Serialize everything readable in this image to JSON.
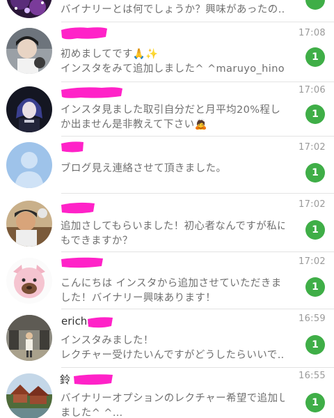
{
  "colors": {
    "badge": "#3fae47",
    "redaction": "#ff22c8",
    "divider": "#e3e3e3"
  },
  "chats": [
    {
      "name": "",
      "time": "",
      "preview_lines": [
        "バイナリーとは何でしょうか？興味があったの…"
      ],
      "unread": "",
      "avatar_icon": "sparkle-photo-avatar-icon"
    },
    {
      "name": "",
      "time": "17:08",
      "preview_lines": [
        "初めましてです🙏✨",
        "インスタをみて追加しました^ ^maruyo_hino…"
      ],
      "unread": "1",
      "avatar_icon": "person-photo-avatar-icon"
    },
    {
      "name": "",
      "time": "17:06",
      "preview_lines": [
        "インスタ見ました取引自分だと月平均20%程し",
        "か出ません是非教えて下さい🙇"
      ],
      "unread": "1",
      "avatar_icon": "anime-character-avatar-icon"
    },
    {
      "name": "",
      "time": "17:02",
      "preview_lines": [
        "ブログ見え連絡させて頂きました。"
      ],
      "unread": "1",
      "avatar_icon": "default-user-avatar-icon"
    },
    {
      "name": "",
      "time": "17:02",
      "preview_lines": [
        "追加さしてもらいました！初心者なんですが私に",
        "もできますか？"
      ],
      "unread": "1",
      "avatar_icon": "man-selfie-avatar-icon"
    },
    {
      "name": "",
      "time": "17:02",
      "preview_lines": [
        "こんにちは インスタから追加させていただきま",
        "した！バイナリー興味あります！"
      ],
      "unread": "1",
      "avatar_icon": "pig-plush-avatar-icon"
    },
    {
      "name": "erichan",
      "time": "16:59",
      "preview_lines": [
        "インスタみました！",
        "レクチャー受けたいんですがどうしたらいいで…"
      ],
      "unread": "1",
      "avatar_icon": "street-photo-avatar-icon"
    },
    {
      "name": "鈴",
      "time": "16:55",
      "preview_lines": [
        "バイナリーオプションのレクチャー希望で追加し",
        "ました^ ^…"
      ],
      "unread": "1",
      "avatar_icon": "garden-photo-avatar-icon"
    }
  ]
}
